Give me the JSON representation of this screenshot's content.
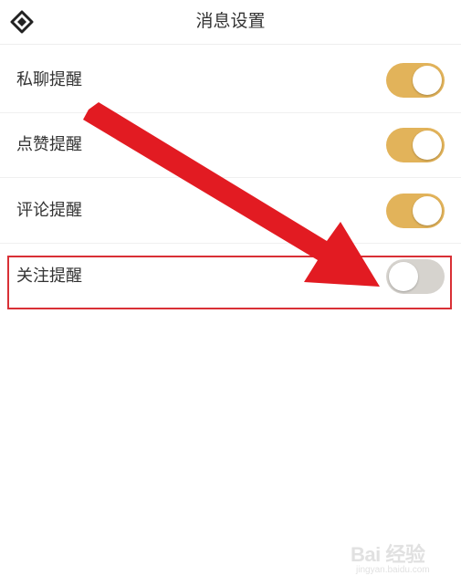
{
  "header": {
    "title": "消息设置",
    "back_icon": "diamond-back-icon"
  },
  "settings": [
    {
      "label": "私聊提醒",
      "enabled": true
    },
    {
      "label": "点赞提醒",
      "enabled": true
    },
    {
      "label": "评论提醒",
      "enabled": true
    },
    {
      "label": "关注提醒",
      "enabled": false
    }
  ],
  "colors": {
    "toggle_on": "#e2b35a",
    "toggle_off": "#d6d3ce",
    "annotation_red": "#e21b22"
  },
  "watermark": {
    "brand": "Bai 经验",
    "url": "jingyan.baidu.com"
  }
}
